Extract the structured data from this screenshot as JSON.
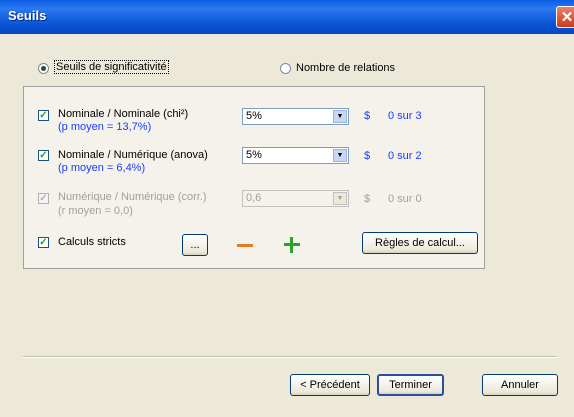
{
  "window": {
    "title": "Seuils",
    "close_symbol": "✕"
  },
  "mode": {
    "option_thresholds": "Seuils de significativité",
    "option_relations": "Nombre de relations",
    "selected": "option_thresholds"
  },
  "rows": [
    {
      "label": "Nominale / Nominale (chi²)",
      "sub": "(p moyen = 13,7%)",
      "value": "5%",
      "dollar": "$",
      "count": "0 sur 3",
      "checked": true,
      "enabled": true
    },
    {
      "label": "Nominale / Numérique (anova)",
      "sub": "(p moyen = 6,4%)",
      "value": "5%",
      "dollar": "$",
      "count": "0 sur 2",
      "checked": true,
      "enabled": true
    },
    {
      "label": "Numérique / Numérique (corr.)",
      "sub": "(r moyen = 0,0)",
      "value": "0,6",
      "dollar": "$",
      "count": "0 sur 0",
      "checked": true,
      "enabled": false
    }
  ],
  "strict": {
    "label": "Calculs stricts",
    "checked": true
  },
  "ellipsis_label": "...",
  "rules_label": "Règles de calcul...",
  "footer": {
    "previous": "< Précédent",
    "finish": "Terminer",
    "cancel": "Annuler"
  },
  "icons": {
    "minus_color": "#e67a1e",
    "plus_color": "#2aa12a",
    "check_color": "#21a121"
  }
}
